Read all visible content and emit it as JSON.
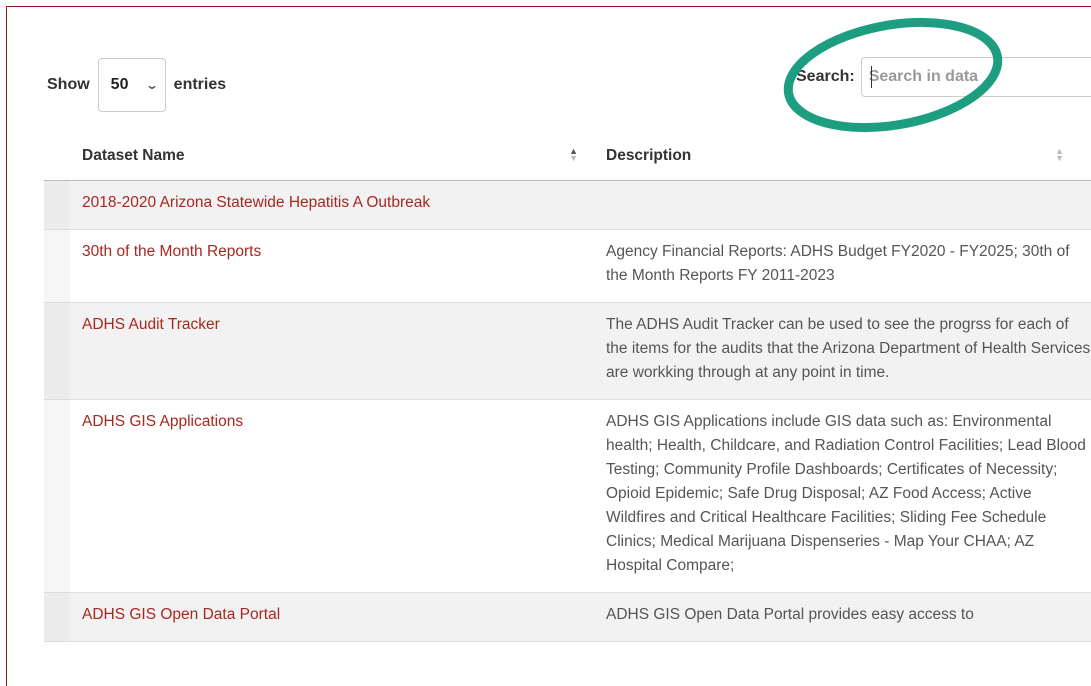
{
  "length": {
    "show_label": "Show",
    "value": "50",
    "entries_label": "entries"
  },
  "search": {
    "label": "Search:",
    "placeholder": "Search in data"
  },
  "table": {
    "columns": [
      "Dataset Name",
      "Description"
    ],
    "rows": [
      {
        "name": "2018-2020 Arizona Statewide Hepatitis A Outbreak",
        "description": ""
      },
      {
        "name": "30th of the Month Reports",
        "description": "Agency Financial Reports: ADHS Budget FY2020 - FY2025; 30th of the Month Reports FY 2011-2023"
      },
      {
        "name": "ADHS Audit Tracker",
        "description": "The ADHS Audit Tracker can be used to see the progrss for each of the items for the audits that the Arizona Department of Health Services are workking through at any point in time."
      },
      {
        "name": "ADHS GIS Applications",
        "description": "ADHS GIS Applications include GIS data such as: Environmental health; Health, Childcare, and Radiation Control Facilities; Lead Blood Testing; Community Profile Dashboards; Certificates of Necessity; Opioid Epidemic; Safe Drug Disposal; AZ Food Access; Active Wildfires and Critical Healthcare Facilities; Sliding Fee Schedule Clinics; Medical Marijuana Dispenseries - Map Your CHAA; AZ Hospital Compare;"
      },
      {
        "name": "ADHS GIS Open Data Portal",
        "description": "ADHS GIS Open Data Portal provides easy access to"
      }
    ]
  },
  "colors": {
    "link": "#a72820",
    "highlight_ring": "#1e9e80",
    "frame": "#8b1c1c"
  }
}
